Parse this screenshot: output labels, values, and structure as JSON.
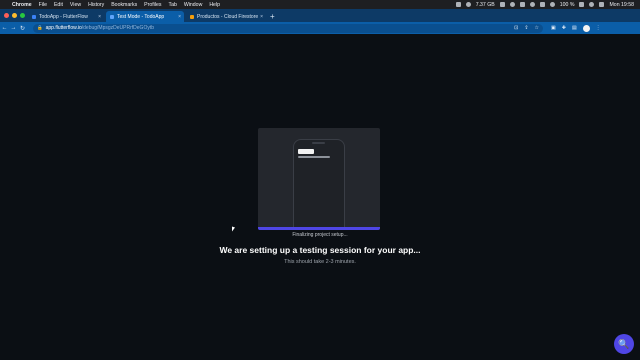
{
  "menubar": {
    "apple_glyph": "",
    "items": [
      "Chrome",
      "File",
      "Edit",
      "View",
      "History",
      "Bookmarks",
      "Profiles",
      "Tab",
      "Window",
      "Help"
    ],
    "memory": "7.37 GB",
    "battery": "100 %",
    "clock": "Mon 19:58"
  },
  "tabs": [
    {
      "title": "TodoApp - FlutterFlow",
      "active": false
    },
    {
      "title": "Test Mode - TodoApp",
      "active": true
    },
    {
      "title": "Productos - Cloud Firestore",
      "active": false
    }
  ],
  "tab_close_glyph": "×",
  "new_tab_glyph": "+",
  "address_bar": {
    "host": "app.flutterflow.io",
    "path": "/debug/MpsgzDeUPRrfDeGOytb"
  },
  "nav": {
    "back": "←",
    "forward": "→",
    "reload": "↻"
  },
  "loading": {
    "progress": 1.0,
    "status": "Finalizing project setup...",
    "headline": "We are setting up a testing session for your app...",
    "subtext": "This should take 2-3 minutes."
  },
  "colors": {
    "accent": "#4f46e5",
    "background": "#0b0f14",
    "card": "#24272d"
  },
  "icons": {
    "help": "🔍"
  }
}
